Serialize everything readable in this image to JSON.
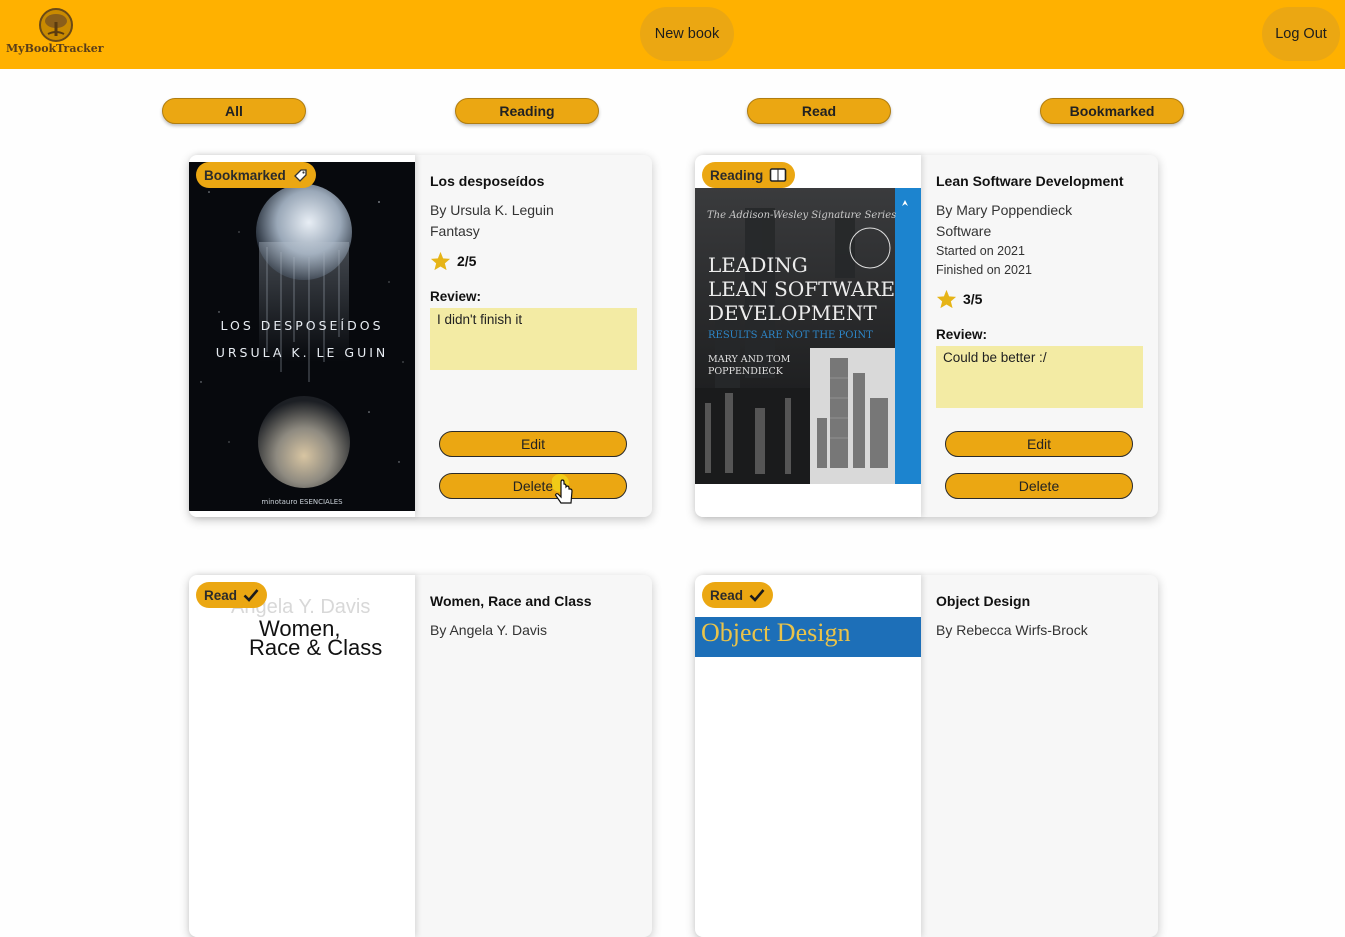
{
  "header": {
    "logo_text": "MyBookTracker",
    "new_book_label": "New book",
    "logout_label": "Log Out"
  },
  "filters": [
    "All",
    "Reading",
    "Read",
    "Bookmarked"
  ],
  "books": [
    {
      "status": "Bookmarked",
      "status_icon": "bookmark-tag-icon",
      "title": "Los desposeídos",
      "author": "By Ursula K. Leguin",
      "genre": "Fantasy",
      "rating": "2/5",
      "review_label": "Review:",
      "review": "I didn't finish it",
      "edit_label": "Edit",
      "delete_label": "Delete",
      "cover": {
        "line1": "LOS DESPOSEÍDOS",
        "line2": "URSULA K. LE GUIN",
        "publisher": "minotauro ESENCIALES"
      }
    },
    {
      "status": "Reading",
      "status_icon": "open-book-icon",
      "title": "Lean Software Development",
      "author": "By Mary Poppendieck",
      "genre": "Software",
      "started": "Started on 2021",
      "finished": "Finished on 2021",
      "rating": "3/5",
      "review_label": "Review:",
      "review": "Could be better :/",
      "edit_label": "Edit",
      "delete_label": "Delete",
      "cover": {
        "series": "The Addison-Wesley Signature Series",
        "line1": "LEADING",
        "line2": "LEAN SOFTWARE",
        "line3": "DEVELOPMENT",
        "subtitle": "RESULTS ARE NOT THE POINT",
        "authors1": "MARY AND TOM",
        "authors2": "POPPENDIECK"
      }
    },
    {
      "status": "Read",
      "status_icon": "checkmark-icon",
      "title": "Women, Race and Class",
      "author": "By Angela Y. Davis",
      "cover": {
        "line1": "Angela Y. Davis",
        "line2": "Women,",
        "line3": "Race & Class"
      }
    },
    {
      "status": "Read",
      "status_icon": "checkmark-icon",
      "title": "Object Design",
      "author": "By Rebecca Wirfs-Brock",
      "cover": {
        "line1": "Object Design"
      }
    }
  ],
  "colors": {
    "header": "#ffb100",
    "accent": "#eba712",
    "review_bg": "#f3eba4",
    "star": "#e6b417"
  }
}
